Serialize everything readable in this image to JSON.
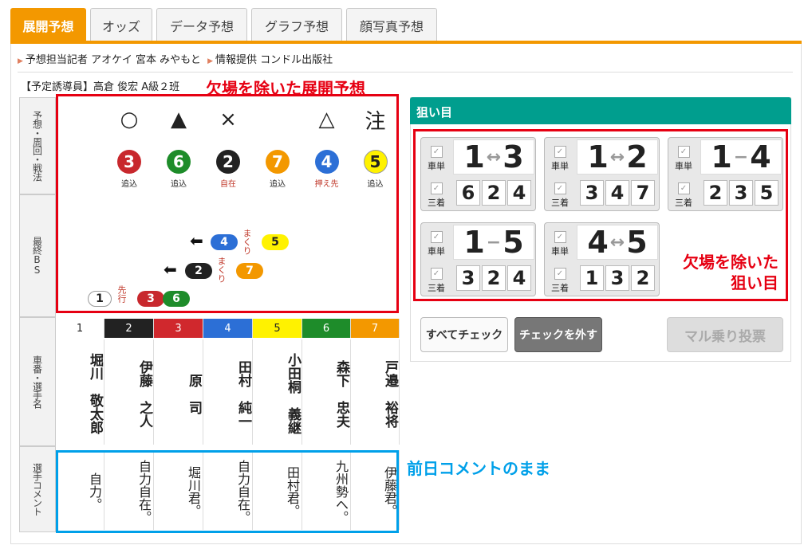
{
  "tabs": [
    {
      "label": "展開予想",
      "active": true
    },
    {
      "label": "オッズ",
      "active": false
    },
    {
      "label": "データ予想",
      "active": false
    },
    {
      "label": "グラフ予想",
      "active": false
    },
    {
      "label": "顔写真予想",
      "active": false
    }
  ],
  "info": {
    "reporter_label": "予想担当記者",
    "reporters": "アオケイ 宮本 みやもと",
    "provider_label": "情報提供",
    "provider": "コンドル出版社"
  },
  "leader": "【予定誘導員】高倉 俊宏 A級２班",
  "annotations": {
    "top": "欠場を除いた展開予想",
    "right": "欠場を除いた\n狙い目",
    "right_line1": "欠場を除いた",
    "right_line2": "狙い目",
    "bottom": "前日コメントのまま"
  },
  "row_headers": {
    "yoso": "予想・周回・戦法",
    "bs": "最終BS",
    "names": "車番・選手名",
    "comment": "選手コメント"
  },
  "marks": [
    "",
    "○",
    "▲",
    "×",
    "",
    "△",
    "注"
  ],
  "picks": [
    {
      "no": "3",
      "color": "#c8282d",
      "text": "#fff",
      "tactic": "追込",
      "tactic_color": "#222"
    },
    {
      "no": "6",
      "color": "#1e8c2a",
      "text": "#fff",
      "tactic": "追込",
      "tactic_color": "#222"
    },
    {
      "no": "2",
      "color": "#222",
      "text": "#fff",
      "tactic": "自在",
      "tactic_color": "#c0392b"
    },
    {
      "no": "7",
      "color": "#f39800",
      "text": "#fff",
      "tactic": "追込",
      "tactic_color": "#222"
    },
    {
      "no": "4",
      "color": "#2c6fd6",
      "text": "#fff",
      "tactic": "押え先",
      "tactic_color": "#c0392b"
    },
    {
      "no": "5",
      "color": "#fff200",
      "text": "#222",
      "tactic": "追込",
      "tactic_color": "#222"
    }
  ],
  "bs": {
    "row1": {
      "no": "4",
      "label": "まくり",
      "follow": "5"
    },
    "row2": {
      "no": "2",
      "label": "まくり",
      "follow": "7"
    },
    "row3": {
      "no": "1",
      "label": "先行",
      "follow1": "3",
      "follow2": "6"
    }
  },
  "riders": [
    {
      "no": "1",
      "bg": "#ffffff",
      "fg": "#222",
      "name": "堀川　敬太郎",
      "comment": "自力。"
    },
    {
      "no": "2",
      "bg": "#222222",
      "fg": "#fff",
      "name": "伊藤　之人",
      "comment": "自力自在。"
    },
    {
      "no": "3",
      "bg": "#d0282d",
      "fg": "#fff",
      "name": "原　司",
      "comment": "堀川君。"
    },
    {
      "no": "4",
      "bg": "#2c6fd6",
      "fg": "#fff",
      "name": "田村　純一",
      "comment": "自力自在。"
    },
    {
      "no": "5",
      "bg": "#fff200",
      "fg": "#222",
      "name": "小田桐　義継",
      "comment": "田村君。"
    },
    {
      "no": "6",
      "bg": "#1e8c2a",
      "fg": "#fff",
      "name": "森下　忠夫",
      "comment": "九州勢へ。"
    },
    {
      "no": "7",
      "bg": "#f39800",
      "fg": "#fff",
      "name": "戸邉　裕将",
      "comment": "伊藤君。"
    }
  ],
  "nerai": {
    "title": "狙い目",
    "tansho_label": "車単",
    "sanchaku_label": "三着",
    "cards": [
      {
        "a": "1",
        "sep": "↔",
        "b": "3",
        "third": [
          "6",
          "2",
          "4"
        ]
      },
      {
        "a": "1",
        "sep": "↔",
        "b": "2",
        "third": [
          "3",
          "4",
          "7"
        ]
      },
      {
        "a": "1",
        "sep": "−",
        "b": "4",
        "third": [
          "2",
          "3",
          "5"
        ]
      },
      {
        "a": "1",
        "sep": "−",
        "b": "5",
        "third": [
          "3",
          "2",
          "4"
        ]
      },
      {
        "a": "4",
        "sep": "↔",
        "b": "5",
        "third": [
          "1",
          "3",
          "2"
        ]
      }
    ]
  },
  "buttons": {
    "check_all": "すべてチェック",
    "uncheck": "チェックを外す",
    "vote": "マル乗り投票"
  },
  "colors": {
    "accent": "#f39800",
    "teal": "#009e8e",
    "red": "#e60012",
    "blue": "#00a0e9"
  }
}
